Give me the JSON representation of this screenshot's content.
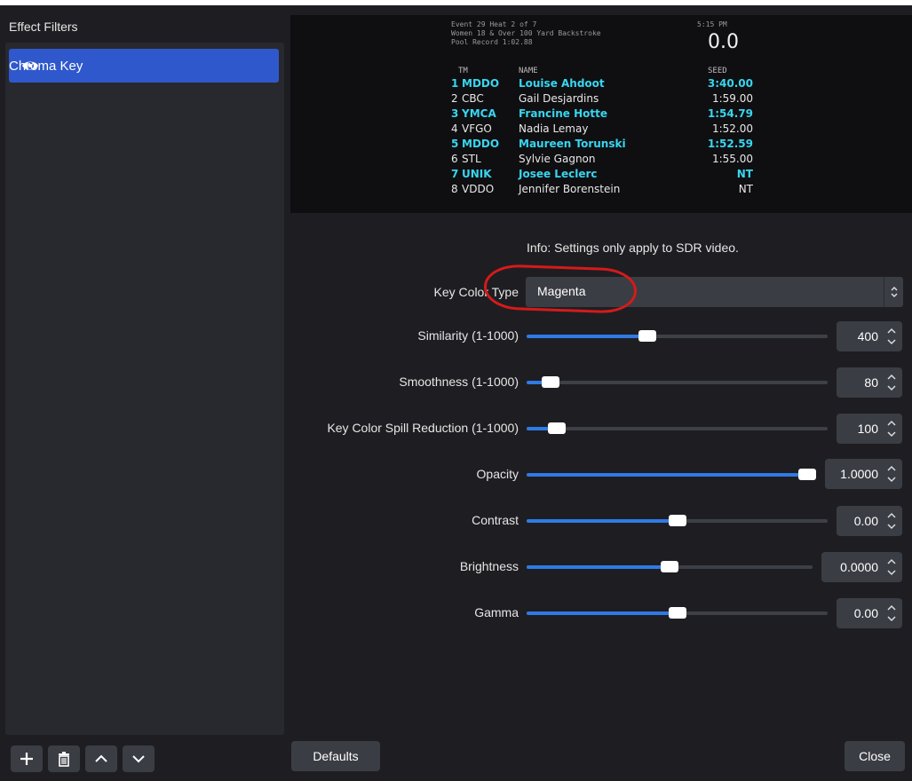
{
  "window": {
    "title": "Effect Filters"
  },
  "filters": [
    {
      "name": "Chroma Key",
      "visible": true
    }
  ],
  "preview": {
    "header_lines": [
      "Event 29  Heat 2 of 7",
      "Women  18 & Over 100 Yard Backstroke",
      "Pool Record  1:02.88"
    ],
    "time_label": "5:15 PM",
    "big_value": "0.0",
    "columns": {
      "team": "TM",
      "name": "NAME",
      "seed": "SEED"
    },
    "rows": [
      {
        "lane": "1",
        "team": "MDDO",
        "name": "Louise Ahdoot",
        "seed": "3:40.00",
        "highlight": true
      },
      {
        "lane": "2",
        "team": "CBC",
        "name": "Gail Desjardins",
        "seed": "1:59.00",
        "highlight": false
      },
      {
        "lane": "3",
        "team": "YMCA",
        "name": "Francine Hotte",
        "seed": "1:54.79",
        "highlight": true
      },
      {
        "lane": "4",
        "team": "VFGO",
        "name": "Nadia Lemay",
        "seed": "1:52.00",
        "highlight": false
      },
      {
        "lane": "5",
        "team": "MDDO",
        "name": "Maureen Torunski",
        "seed": "1:52.59",
        "highlight": true
      },
      {
        "lane": "6",
        "team": "STL",
        "name": "Sylvie Gagnon",
        "seed": "1:55.00",
        "highlight": false
      },
      {
        "lane": "7",
        "team": "UNIK",
        "name": "Josee Leclerc",
        "seed": "NT",
        "highlight": true
      },
      {
        "lane": "8",
        "team": "VDDO",
        "name": "Jennifer Borenstein",
        "seed": "NT",
        "highlight": false
      }
    ]
  },
  "settings": {
    "info": "Info: Settings only apply to SDR video.",
    "key_color_type": {
      "label": "Key Color Type",
      "value": "Magenta"
    },
    "similarity": {
      "label": "Similarity (1-1000)",
      "value": "400",
      "fraction": 0.4
    },
    "smoothness": {
      "label": "Smoothness (1-1000)",
      "value": "80",
      "fraction": 0.08
    },
    "spill": {
      "label": "Key Color Spill Reduction (1-1000)",
      "value": "100",
      "fraction": 0.1
    },
    "opacity": {
      "label": "Opacity",
      "value": "1.0000",
      "fraction": 1.0
    },
    "contrast": {
      "label": "Contrast",
      "value": "0.00",
      "fraction": 0.5
    },
    "brightness": {
      "label": "Brightness",
      "value": "0.0000",
      "fraction": 0.5
    },
    "gamma": {
      "label": "Gamma",
      "value": "0.00",
      "fraction": 0.5
    }
  },
  "buttons": {
    "defaults": "Defaults",
    "close": "Close"
  },
  "colors": {
    "accent": "#2f7ae5",
    "selection": "#2f58cc",
    "annotation": "#d61a1a",
    "highlight_text": "#38d6f0"
  }
}
